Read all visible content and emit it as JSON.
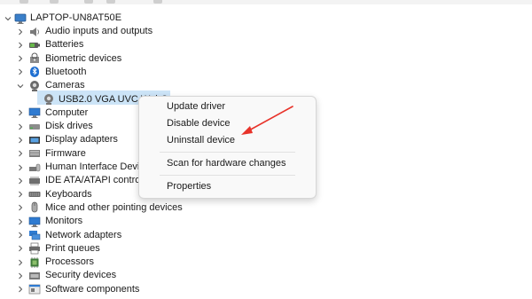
{
  "root": {
    "label": "LAPTOP-UN8AT50E",
    "icon": "computer-icon"
  },
  "categories": [
    {
      "label": "Audio inputs and outputs",
      "icon": "speaker-icon",
      "expanded": false
    },
    {
      "label": "Batteries",
      "icon": "battery-icon",
      "expanded": false
    },
    {
      "label": "Biometric devices",
      "icon": "fingerprint-icon",
      "expanded": false
    },
    {
      "label": "Bluetooth",
      "icon": "bluetooth-icon",
      "expanded": false
    },
    {
      "label": "Cameras",
      "icon": "camera-icon",
      "expanded": true
    },
    {
      "label": "Computer",
      "icon": "monitor-icon",
      "expanded": false
    },
    {
      "label": "Disk drives",
      "icon": "disk-icon",
      "expanded": false
    },
    {
      "label": "Display adapters",
      "icon": "display-adapter-icon",
      "expanded": false
    },
    {
      "label": "Firmware",
      "icon": "firmware-icon",
      "expanded": false
    },
    {
      "label": "Human Interface Device",
      "icon": "hid-icon",
      "expanded": false
    },
    {
      "label": "IDE ATA/ATAPI controllers",
      "icon": "ide-controller-icon",
      "expanded": false
    },
    {
      "label": "Keyboards",
      "icon": "keyboard-icon",
      "expanded": false
    },
    {
      "label": "Mice and other pointing devices",
      "icon": "mouse-icon",
      "expanded": false
    },
    {
      "label": "Monitors",
      "icon": "monitor-icon",
      "expanded": false
    },
    {
      "label": "Network adapters",
      "icon": "network-icon",
      "expanded": false
    },
    {
      "label": "Print queues",
      "icon": "printer-icon",
      "expanded": false
    },
    {
      "label": "Processors",
      "icon": "processor-icon",
      "expanded": false
    },
    {
      "label": "Security devices",
      "icon": "security-icon",
      "expanded": false
    },
    {
      "label": "Software components",
      "icon": "software-icon",
      "expanded": false
    }
  ],
  "camera_child": {
    "label": "USB2.0 VGA UVC WebCam",
    "icon": "webcam-icon",
    "selected": true
  },
  "context_menu": {
    "items": [
      {
        "label": "Update driver"
      },
      {
        "label": "Disable device"
      },
      {
        "label": "Uninstall device",
        "highlighted_by_annotation": true
      },
      {
        "label": "Scan for hardware changes"
      },
      {
        "label": "Properties"
      }
    ]
  },
  "annotation": {
    "type": "arrow",
    "color": "#e8332a",
    "points_to": "Uninstall device"
  },
  "colors": {
    "selection": "#cce4f7",
    "menu_bg": "#f9f9f9",
    "text": "#1a1a1a"
  }
}
